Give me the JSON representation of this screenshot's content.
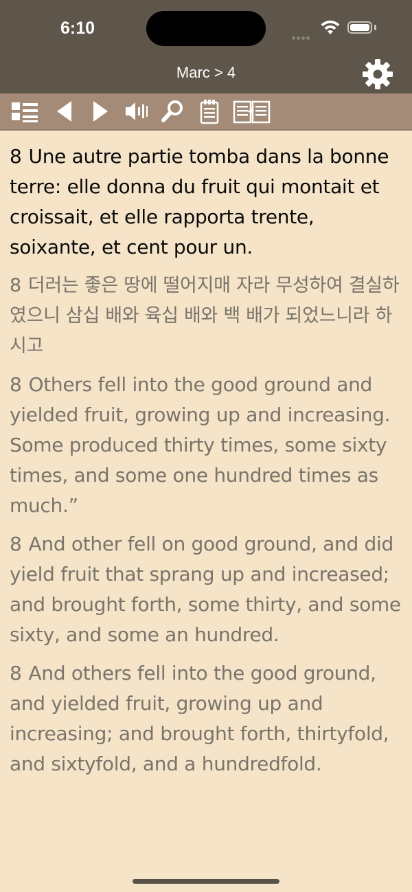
{
  "status_bar": {
    "time": "6:10"
  },
  "header": {
    "title": "Marc > 4"
  },
  "toolbar": {
    "icons": [
      "list-icon",
      "previous-icon",
      "next-icon",
      "speaker-icon",
      "search-icon",
      "notes-icon",
      "compare-icon"
    ]
  },
  "verses": [
    {
      "number": "8",
      "text": "Une autre partie tomba dans la bonne terre: elle donna du fruit qui montait et croissait, et elle rapporta trente, soixante, et cent pour un."
    },
    {
      "number": "8",
      "text": "더러는 좋은 땅에 떨어지매 자라 무성하여 결실하였으니 삼십 배와 육십 배와 백 배가 되었느니라 하시고"
    },
    {
      "number": "8",
      "text": "Others fell into the good ground and yielded fruit, growing up and increasing. Some produced thirty times, some sixty times, and some one hundred times as much.”"
    },
    {
      "number": "8",
      "text": "And other fell on good ground, and did yield fruit that sprang up and increased; and brought forth, some thirty, and some sixty, and some an hundred."
    },
    {
      "number": "8",
      "text": "And others fell into the good ground, and yielded fruit, growing up and increasing; and brought forth, thirtyfold, and sixtyfold, and a hundredfold."
    }
  ],
  "colors": {
    "background": "#f5e4c8",
    "nav": "#5e564b",
    "toolbar": "#a38b77",
    "primary_text": "#0a0a0a",
    "secondary_text": "#7a746b"
  }
}
